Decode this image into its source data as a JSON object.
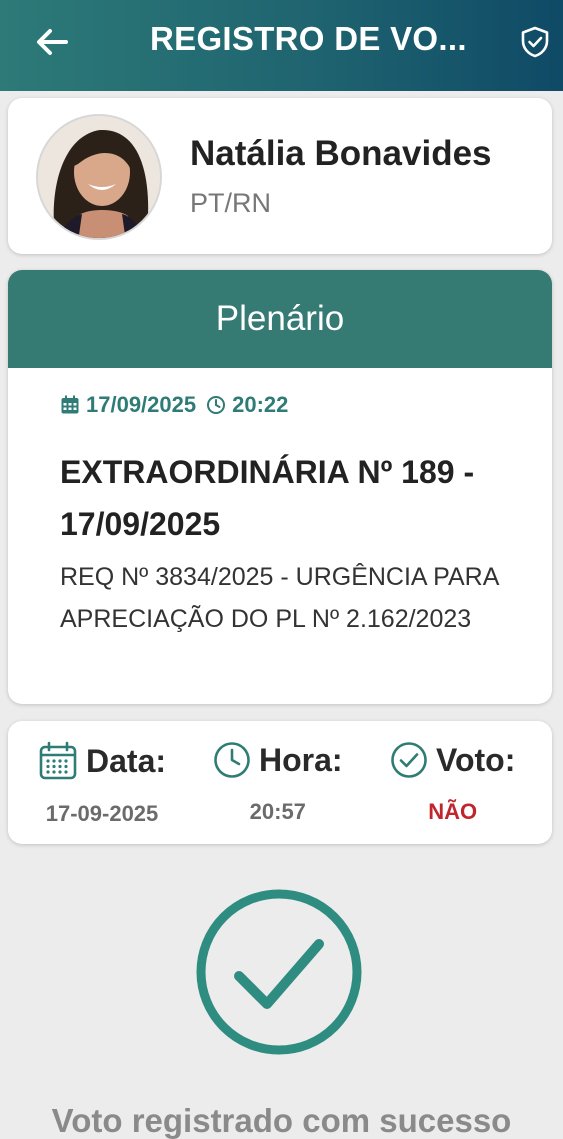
{
  "appbar": {
    "title": "REGISTRO DE VO...",
    "back_icon": "arrow-left-icon",
    "right_icon": "shield-check-icon",
    "gradient_colors": [
      "#2d7a78",
      "#0f4a66"
    ]
  },
  "profile": {
    "name": "Natália Bonavides",
    "party": "PT/RN"
  },
  "session": {
    "header": "Plenário",
    "date": "17/09/2025",
    "time": "20:22",
    "title": "EXTRAORDINÁRIA Nº 189 - 17/09/2025",
    "description": "REQ Nº 3834/2025 - URGÊNCIA PARA APRECIAÇÃO DO PL Nº 2.162/2023",
    "accent_color": "#367a74"
  },
  "vote": {
    "date_label": "Data:",
    "date_value": "17-09-2025",
    "time_label": "Hora:",
    "time_value": "20:57",
    "vote_label": "Voto:",
    "vote_value": "NÃO",
    "vote_value_color": "#c0262d"
  },
  "success": {
    "icon": "check-circle-icon",
    "message": "Voto registrado com sucesso"
  }
}
